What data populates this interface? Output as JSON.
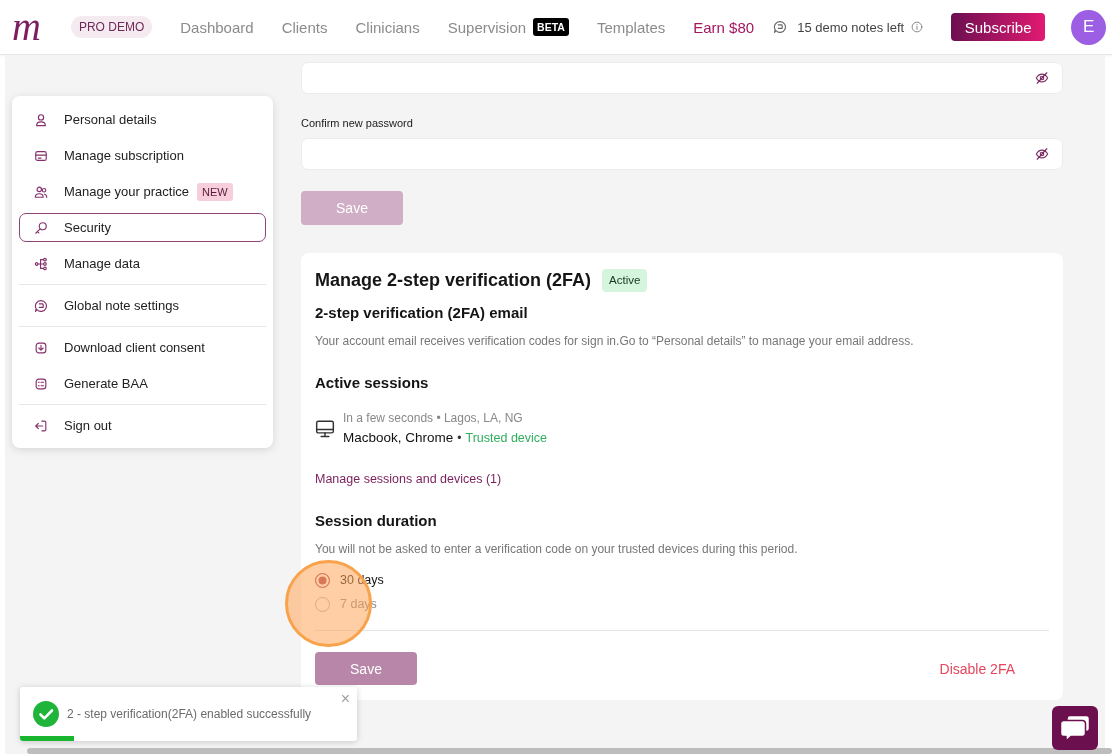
{
  "header": {
    "logo": "m",
    "plan_badge": "PRO DEMO",
    "nav": [
      {
        "label": "Dashboard",
        "selected": false
      },
      {
        "label": "Clients",
        "selected": false
      },
      {
        "label": "Clinicians",
        "selected": false
      },
      {
        "label": "Supervision",
        "selected": false,
        "badge": "BETA"
      },
      {
        "label": "Templates",
        "selected": false
      }
    ],
    "promo_link": "Earn $80",
    "demo_notes": "15 demo notes left",
    "subscribe_button": "Subscribe",
    "avatar_initial": "E"
  },
  "sidebar": {
    "groups": [
      {
        "items": [
          {
            "label": "Personal details",
            "selected": false
          },
          {
            "label": "Manage subscription",
            "selected": false
          },
          {
            "label": "Manage your practice",
            "selected": false,
            "badge": "NEW"
          },
          {
            "label": "Security",
            "selected": true
          },
          {
            "label": "Manage data",
            "selected": false
          }
        ]
      },
      {
        "items": [
          {
            "label": "Global note settings",
            "selected": false
          }
        ]
      },
      {
        "items": [
          {
            "label": "Download client consent",
            "selected": false
          },
          {
            "label": "Generate BAA",
            "selected": false
          }
        ]
      },
      {
        "items": [
          {
            "label": "Sign out",
            "selected": false
          }
        ]
      }
    ]
  },
  "password_form": {
    "fields": [
      {
        "visible": false
      },
      {
        "label": "Confirm new password",
        "visible": false
      }
    ],
    "save_button": {
      "label": "Save",
      "disabled": true
    }
  },
  "two_factor": {
    "title": "Manage 2-step verification (2FA)",
    "status": "Active",
    "email": {
      "heading": "2-step verification (2FA) email",
      "text": "Your account email receives verification codes for sign in.Go to “Personal details” to manage your email address."
    },
    "sessions": {
      "heading": "Active sessions",
      "items": [
        {
          "meta": "In a few seconds • Lagos, LA, NG",
          "device": "Macbook, Chrome",
          "separator": "•",
          "trust_label": "Trusted device"
        }
      ],
      "manage_link": "Manage sessions and devices (1)"
    },
    "duration": {
      "heading": "Session duration",
      "text": "You will not be asked to enter a verification code on your trusted devices during this period.",
      "options": [
        {
          "label": "30 days",
          "selected": true
        },
        {
          "label": "7 days",
          "selected": false
        }
      ]
    },
    "save_button": {
      "label": "Save",
      "disabled": false
    },
    "disable_button": "Disable 2FA"
  },
  "toast": {
    "message": "2 - step verification(2FA) enabled successfully",
    "close": "×",
    "level": 0.16
  },
  "click_highlight": true
}
